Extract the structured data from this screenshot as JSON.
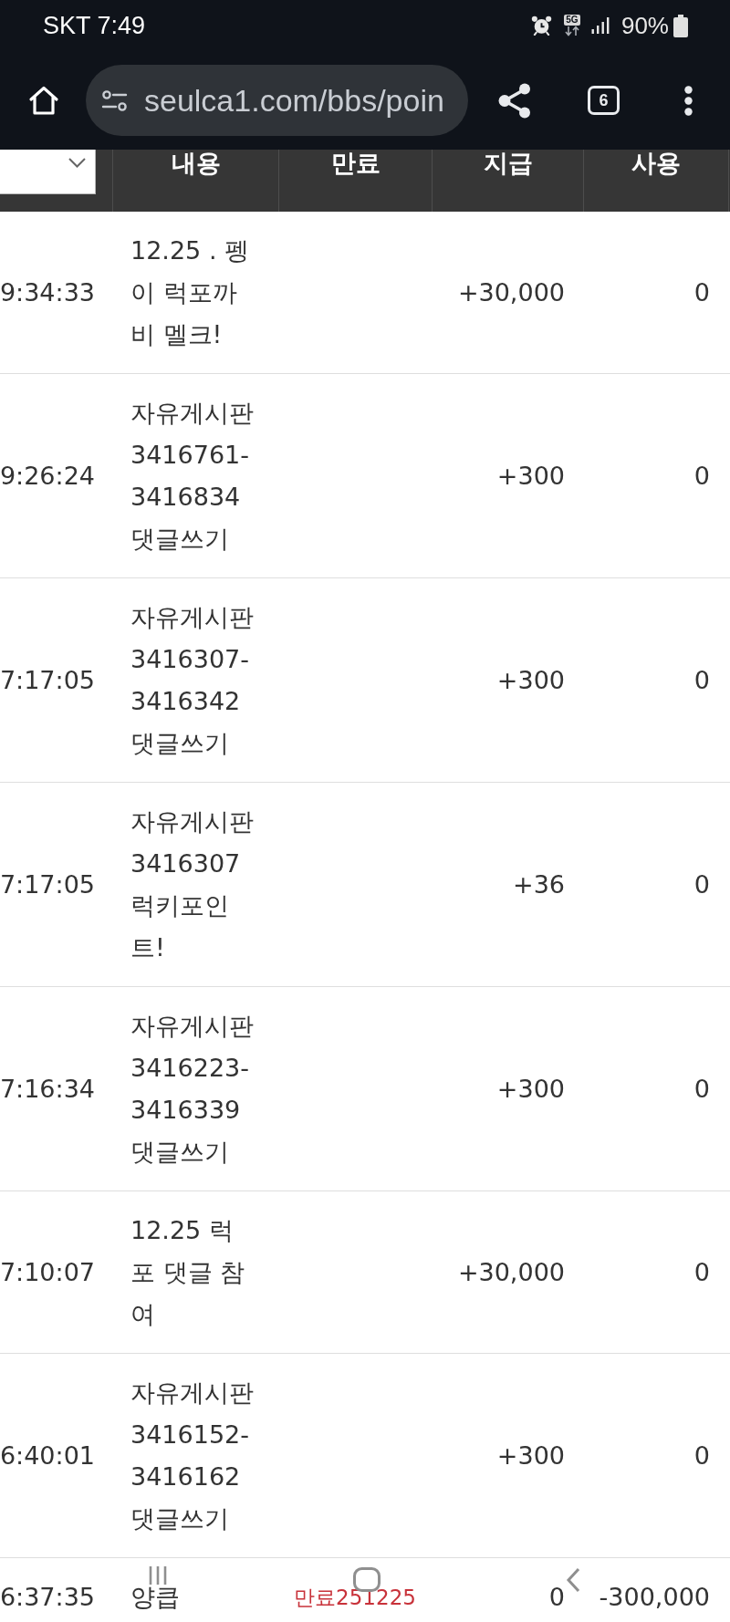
{
  "status_bar": {
    "carrier": "SKT",
    "clock": "7:49",
    "network_type": "5G",
    "battery": "90%"
  },
  "browser_toolbar": {
    "url": "seulca1.com/bbs/poin",
    "tab_count": "6"
  },
  "table": {
    "columns": [
      {
        "kind": "select"
      },
      {
        "kind": "label",
        "label": "내용"
      },
      {
        "kind": "label",
        "label": "만료"
      },
      {
        "kind": "label",
        "label": "지급"
      },
      {
        "kind": "label",
        "label": "사용"
      }
    ],
    "rows": [
      {
        "column_1": "9:34:33",
        "content": "12.25 . 펭이 럭포까비 멜크!",
        "earned": "+30,000",
        "used": "0"
      },
      {
        "column_1": "9:26:24",
        "content": "자유게시판 3416761-3416834 댓글쓰기",
        "earned": "+300",
        "used": "0"
      },
      {
        "column_1": "7:17:05",
        "content": "자유게시판 3416307-3416342 댓글쓰기",
        "earned": "+300",
        "used": "0"
      },
      {
        "column_1": "7:17:05",
        "content": "자유게시판 3416307 럭키포인트!",
        "earned": "+36",
        "used": "0"
      },
      {
        "column_1": "7:16:34",
        "content": "자유게시판 3416223-3416339 댓글쓰기",
        "earned": "+300",
        "used": "0"
      },
      {
        "column_1": "7:10:07",
        "content": "12.25 럭포 댓글 참여",
        "earned": "+30,000",
        "used": "0"
      },
      {
        "column_1": "6:40:01",
        "content": "자유게시판 3416152-3416162 댓글쓰기",
        "earned": "+300",
        "used": "0"
      },
      {
        "column_1": "6:37:35",
        "content": "양큽",
        "expiry": "만료251225",
        "earned": "0",
        "used": "-300,000"
      }
    ]
  }
}
